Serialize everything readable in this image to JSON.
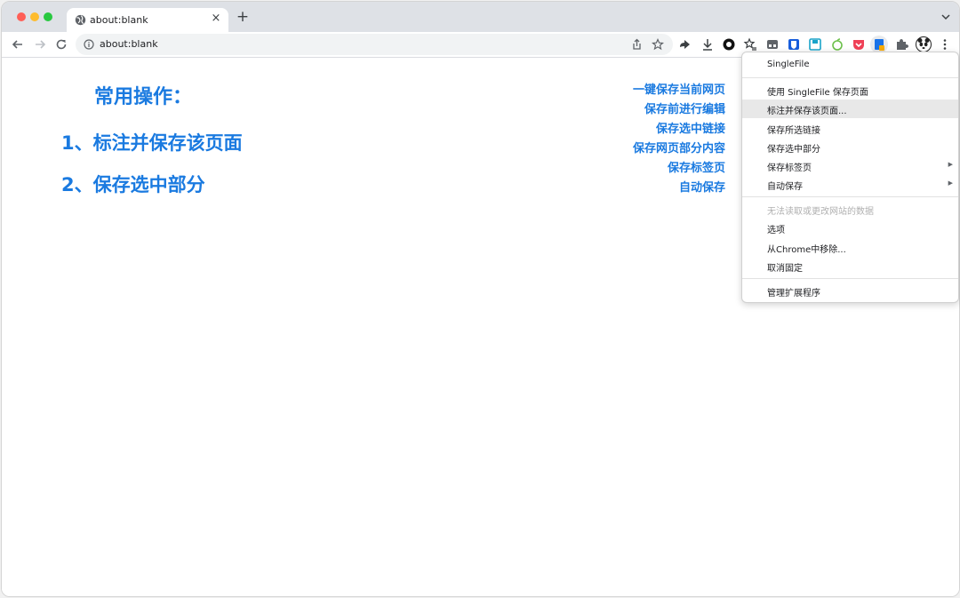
{
  "browser": {
    "tab": {
      "title": "about:blank",
      "close": "×"
    },
    "new_tab": "+",
    "address": {
      "url": "about:blank"
    }
  },
  "page": {
    "heading": "常用操作：",
    "items": [
      "1、标注并保存该页面",
      "2、保存选中部分"
    ],
    "quick_actions": [
      "一键保存当前网页",
      "保存前进行编辑",
      "保存选中链接",
      "保存网页部分内容",
      "保存标签页",
      "自动保存"
    ]
  },
  "menu": {
    "title": "SingleFile",
    "items": [
      {
        "label": "使用 SingleFile 保存页面"
      },
      {
        "label": "标注并保存该页面..."
      },
      {
        "label": "保存所选链接"
      },
      {
        "label": "保存选中部分"
      },
      {
        "label": "保存标签页",
        "submenu": "▶"
      },
      {
        "label": "自动保存",
        "submenu": "▶"
      }
    ],
    "disabled_note": "无法读取或更改网站的数据",
    "options": "选项",
    "remove": "从Chrome中移除...",
    "unpin": "取消固定",
    "manage": "管理扩展程序"
  },
  "colors": {
    "accent": "#1a7ae0",
    "highlight": "#e8e8e8",
    "tabstrip": "#dee1e6"
  },
  "icons": [
    "globe-icon",
    "close-icon",
    "plus-icon",
    "back-icon",
    "forward-icon",
    "reload-icon",
    "info-icon",
    "share-icon",
    "star-icon",
    "download-icon",
    "puzzle-icon",
    "menu-dots-icon"
  ]
}
